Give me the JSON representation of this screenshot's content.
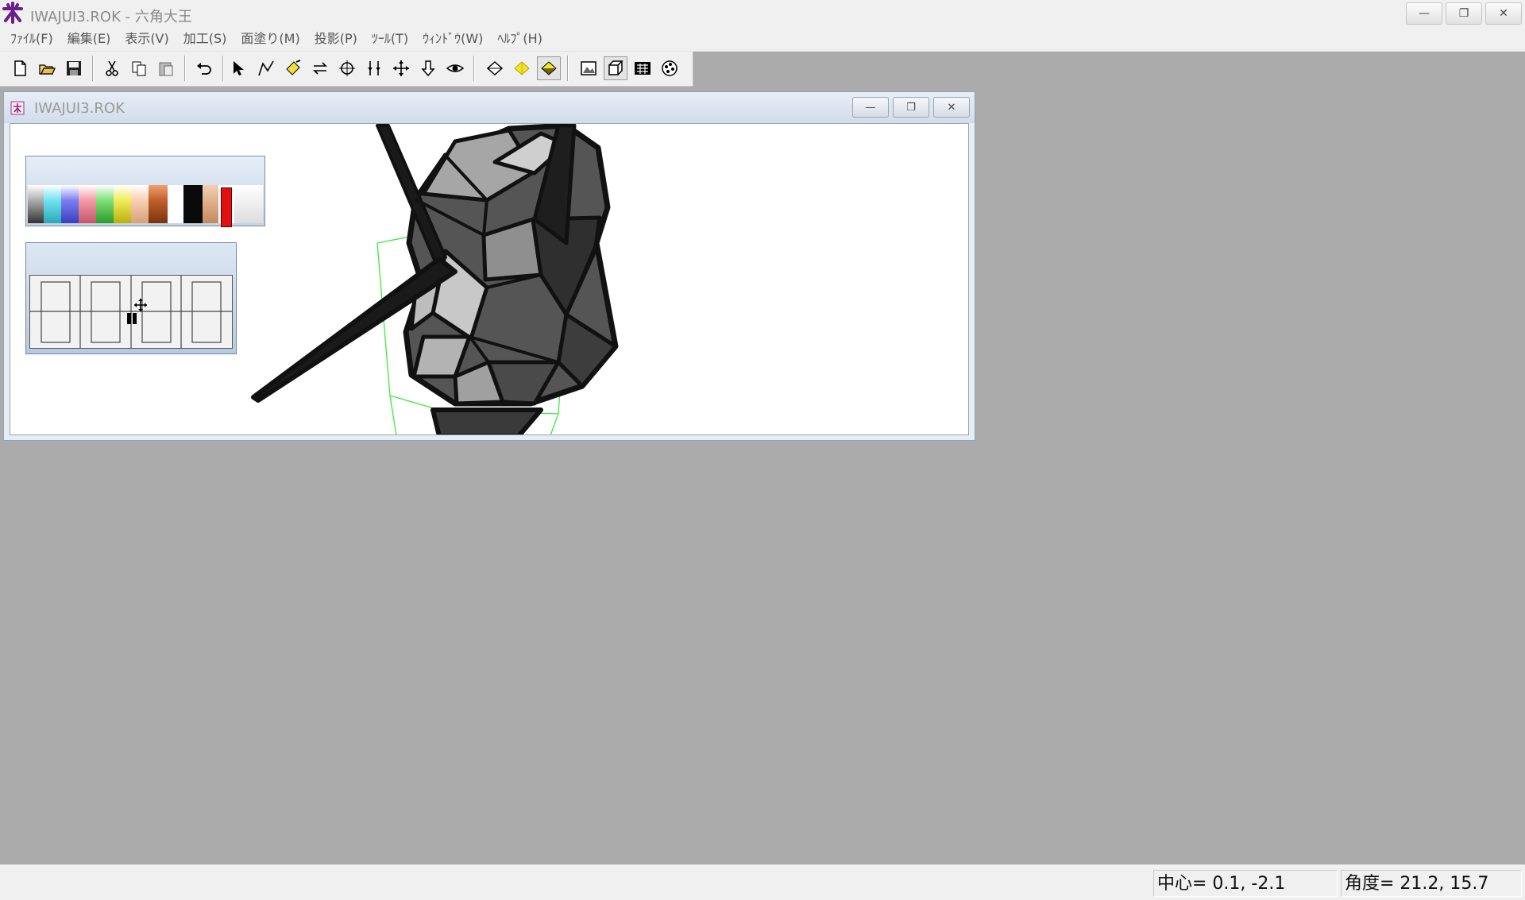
{
  "window": {
    "title": "IWAJUI3.ROK - 六角大王",
    "minimize": "—",
    "restore": "❐",
    "close": "✕"
  },
  "menu": [
    "ﾌｧｲﾙ(F)",
    "編集(E)",
    "表示(V)",
    "加工(S)",
    "面塗り(M)",
    "投影(P)",
    "ﾂｰﾙ(T)",
    "ｳｨﾝﾄﾞｳ(W)",
    "ﾍﾙﾌﾟ(H)"
  ],
  "toolbar": {
    "icons": [
      "new-file-icon",
      "open-folder-icon",
      "save-icon",
      "cut-icon",
      "copy-icon",
      "paste-icon",
      "undo-icon",
      "select-arrow-icon",
      "polyline-icon",
      "paint-icon",
      "swap-icon",
      "rotate-icon",
      "mirror-icon",
      "move-icon",
      "pull-icon",
      "eye-icon",
      "view-front-icon",
      "light-icon",
      "view-shade-icon",
      "render-icon",
      "cube-icon",
      "grid-view-icon",
      "material-icon"
    ],
    "pressed": [
      "view-shade-icon"
    ]
  },
  "child_window": {
    "title": "IWAJUI3.ROK",
    "minimize": "—",
    "restore": "❐",
    "close": "✕"
  },
  "palette": {
    "colors": [
      "#333333",
      "#6fe3f0",
      "#7b7ff0",
      "#f59aa6",
      "#7de07a",
      "#f0ec58",
      "#f6d0b2",
      "#c0602a",
      "#ffffff",
      "#0a0a0a",
      "#e0b28e",
      "#e01010",
      "#eeeeee"
    ]
  },
  "status": {
    "center": "中心=  0.1,  -2.1",
    "angle": "角度=  21.2,  15.7"
  }
}
